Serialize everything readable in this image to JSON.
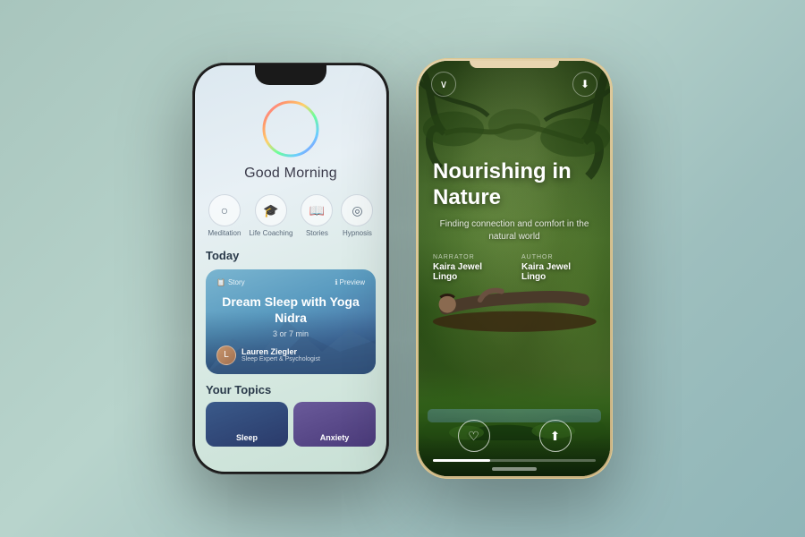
{
  "background": {
    "color_start": "#a8c5bd",
    "color_end": "#8fb5b8"
  },
  "phone1": {
    "greeting": "Good Morning",
    "categories": [
      {
        "icon": "○",
        "label": "Meditation"
      },
      {
        "icon": "🎓",
        "label": "Life Coaching"
      },
      {
        "icon": "📖",
        "label": "Stories"
      },
      {
        "icon": "◎",
        "label": "Hypnosis"
      }
    ],
    "today_label": "Today",
    "story_card": {
      "badge": "Story",
      "preview_label": "Preview",
      "title": "Dream Sleep with Yoga Nidra",
      "duration": "3 or 7 min",
      "author_name": "Lauren Ziegler",
      "author_title": "Sleep Expert & Psychologist"
    },
    "your_topics_label": "Your Topics",
    "topics": [
      {
        "label": "Sleep"
      },
      {
        "label": "Anxiety"
      }
    ]
  },
  "phone2": {
    "title": "Nourishing in Nature",
    "subtitle": "Finding connection and comfort in the natural world",
    "narrator_role": "NARRATOR",
    "narrator_name": "Kaira Jewel Lingo",
    "author_role": "AUTHOR",
    "author_name": "Kaira Jewel Lingo",
    "controls": {
      "heart_label": "♡",
      "share_label": "⬆"
    }
  }
}
